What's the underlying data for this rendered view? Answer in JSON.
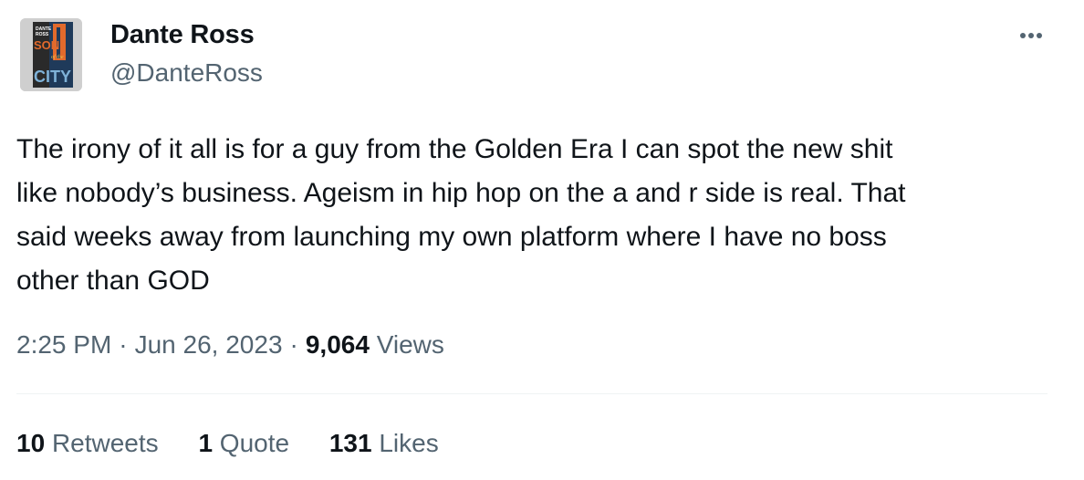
{
  "author": {
    "name": "Dante Ross",
    "handle": "@DanteRoss",
    "avatar_text": [
      "DANTE",
      "ROSS",
      "SON",
      "of the",
      "CITY"
    ]
  },
  "tweet": {
    "text": "The irony of it all is for a guy from the Golden Era I can spot the new shit\nlike nobody’s business. Ageism in hip hop on the a and r side is real. That\nsaid weeks away from launching my own platform where I have no boss\nother than GOD",
    "time": "2:25 PM",
    "separator": "·",
    "date": "Jun 26, 2023",
    "views_count": "9,064",
    "views_label": "Views"
  },
  "stats": {
    "retweets_count": "10",
    "retweets_label": "Retweets",
    "quotes_count": "1",
    "quotes_label": "Quote",
    "likes_count": "131",
    "likes_label": "Likes"
  },
  "icons": {
    "more": "more-dots-icon"
  },
  "colors": {
    "text_primary": "#0f1419",
    "text_secondary": "#536471",
    "divider": "#eff3f4"
  }
}
